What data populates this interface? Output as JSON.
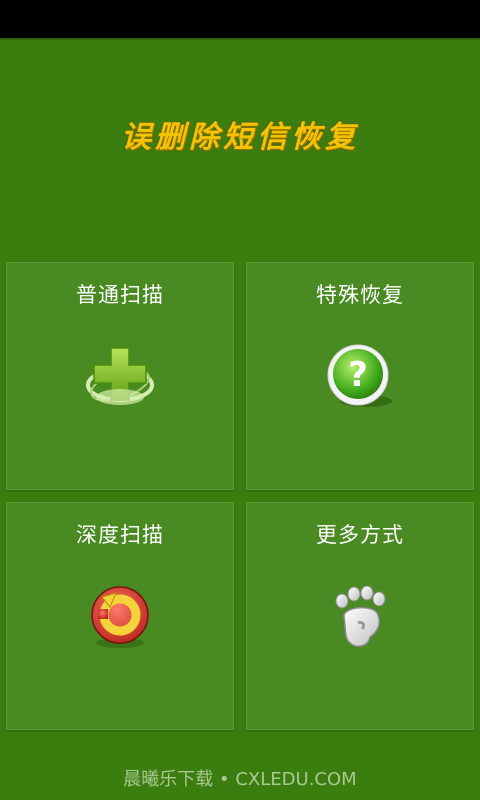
{
  "app": {
    "title": "误删除短信恢复"
  },
  "tiles": [
    {
      "label": "普通扫描",
      "icon": "green-plus-icon"
    },
    {
      "label": "特殊恢复",
      "icon": "question-mark-icon"
    },
    {
      "label": "深度扫描",
      "icon": "refresh-arrow-icon"
    },
    {
      "label": "更多方式",
      "icon": "footprint-icon"
    }
  ],
  "footer": {
    "watermark": "晨曦乐下载 • CXLEDU.COM"
  },
  "colors": {
    "background": "#3c7d0f",
    "tile": "#4a8a22",
    "title": "#f2c300",
    "status_bar": "#000000"
  }
}
